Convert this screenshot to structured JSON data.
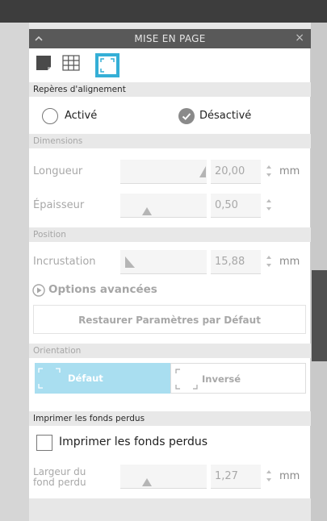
{
  "panel": {
    "title": "MISE EN PAGE",
    "close_glyph": "×"
  },
  "tabs": [
    {
      "icon": "page-setup-icon",
      "selected": false
    },
    {
      "icon": "grid-icon",
      "selected": false
    },
    {
      "icon": "registration-marks-icon",
      "selected": true
    }
  ],
  "alignment": {
    "header": "Repères d'alignement",
    "option_on": "Activé",
    "option_off": "Désactivé",
    "selected": "Désactivé"
  },
  "dimensions": {
    "header": "Dimensions",
    "length_label": "Longueur",
    "length_value": "20,00",
    "thickness_label": "Épaisseur",
    "thickness_value": "0,50",
    "unit": "mm"
  },
  "position": {
    "header": "Position",
    "inset_label": "Incrustation",
    "inset_value": "15,88",
    "unit": "mm"
  },
  "advanced": {
    "label": "Options avancées"
  },
  "reset_button": "Restaurer Paramètres par Défaut",
  "orientation": {
    "header": "Orientation",
    "default_label": "Défaut",
    "inverse_label": "Inversé",
    "selected": "Défaut"
  },
  "bleed": {
    "header": "Imprimer les fonds perdus",
    "checkbox_label": "Imprimer les fonds perdus",
    "checked": false,
    "width_label_line1": "Largeur du",
    "width_label_line2": "fond perdu",
    "width_value": "1,27",
    "unit": "mm"
  },
  "colors": {
    "accent": "#35afd6",
    "selected_fill": "#a9def0",
    "titlebar": "#595959"
  }
}
